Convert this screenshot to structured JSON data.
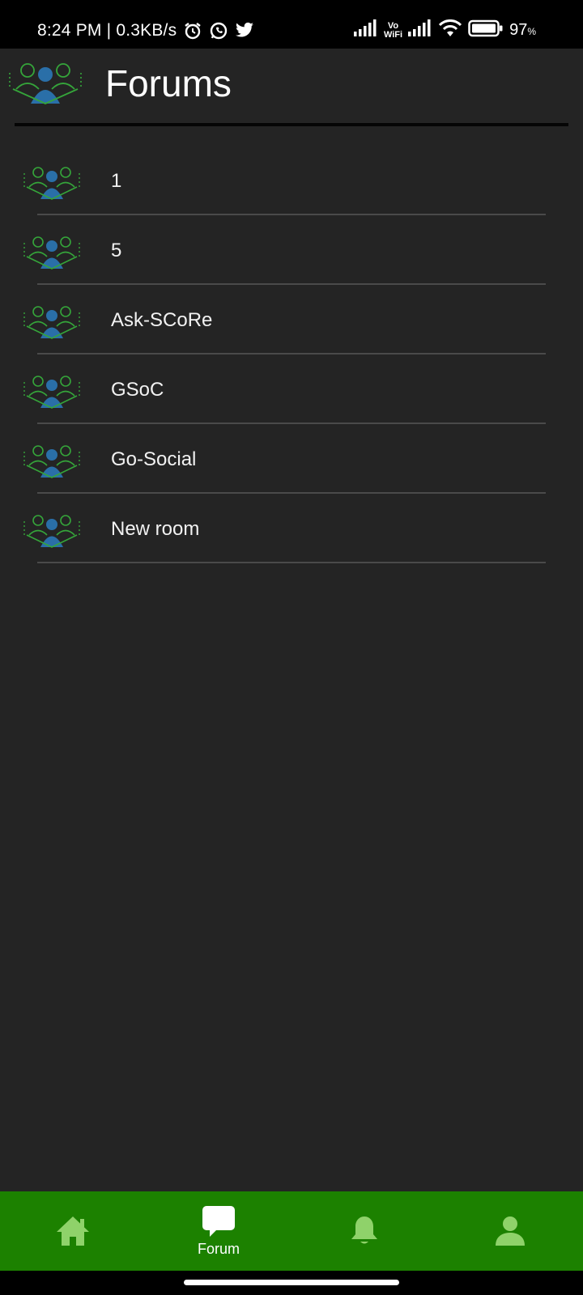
{
  "status_bar": {
    "time": "8:24 PM",
    "net_speed": "0.3KB/s",
    "vowifi_top": "Vo",
    "vowifi_bottom": "WiFi",
    "battery_value": "97",
    "battery_unit": "%",
    "icons": [
      "alarm-icon",
      "whatsapp-icon",
      "twitter-icon",
      "signal-icon",
      "vowifi-icon",
      "signal-icon",
      "wifi-icon",
      "battery-icon"
    ]
  },
  "header": {
    "title": "Forums",
    "logo_icon": "group-icon"
  },
  "forums": [
    {
      "label": "1",
      "icon": "group-icon"
    },
    {
      "label": "5",
      "icon": "group-icon"
    },
    {
      "label": "Ask-SCoRe",
      "icon": "group-icon"
    },
    {
      "label": "GSoC",
      "icon": "group-icon"
    },
    {
      "label": "Go-Social",
      "icon": "group-icon"
    },
    {
      "label": "New room",
      "icon": "group-icon"
    }
  ],
  "bottom_nav": {
    "items": [
      {
        "icon": "home-icon",
        "label": ""
      },
      {
        "icon": "chat-icon",
        "label": "Forum"
      },
      {
        "icon": "bell-icon",
        "label": ""
      },
      {
        "icon": "person-icon",
        "label": ""
      }
    ],
    "active_index": 1
  },
  "colors": {
    "background": "#242424",
    "nav_bar": "#1c8100",
    "nav_icon_inactive": "#8fd26a",
    "nav_icon_active": "#ffffff",
    "icon_blue": "#2a6fa8",
    "icon_green": "#35a53a"
  }
}
